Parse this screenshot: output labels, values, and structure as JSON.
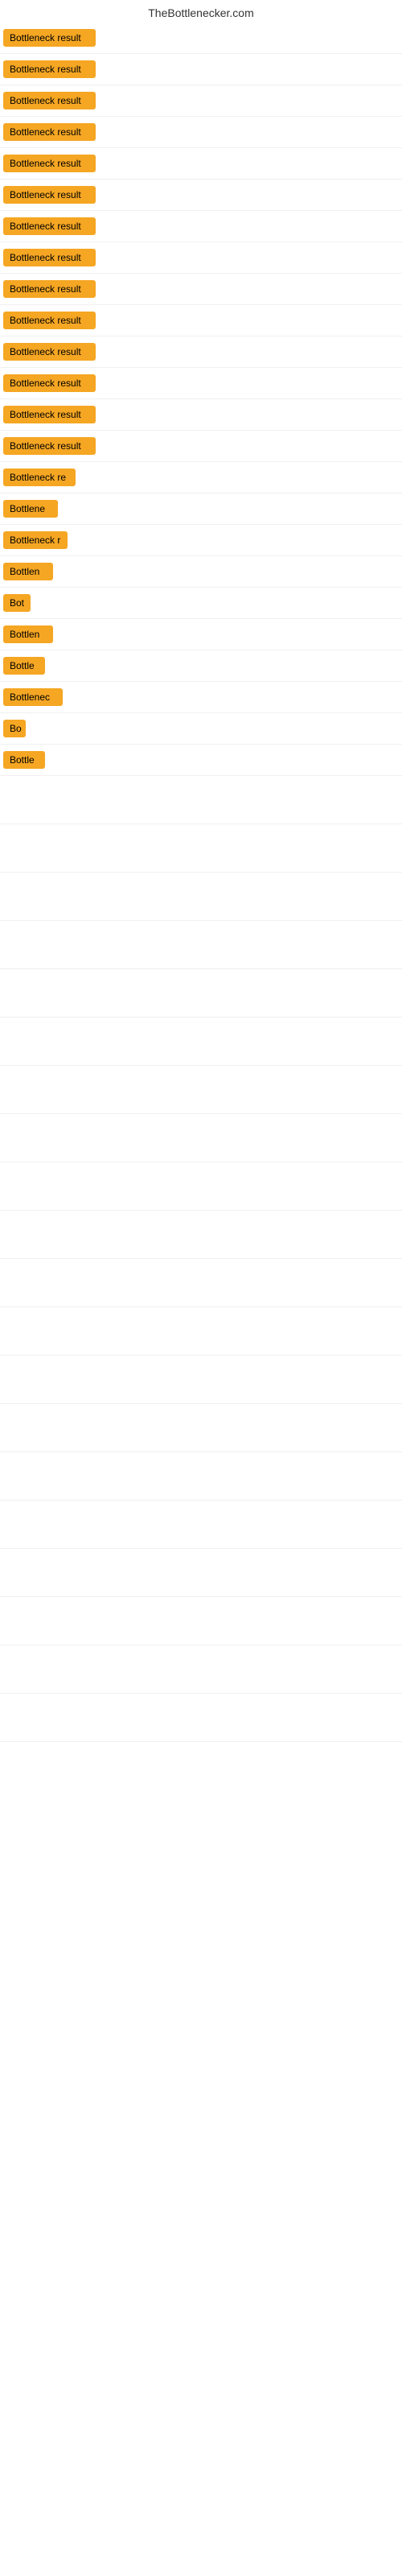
{
  "site": {
    "title": "TheBottlenecker.com"
  },
  "results": [
    {
      "id": 1,
      "label": "Bottleneck result",
      "width": 115
    },
    {
      "id": 2,
      "label": "Bottleneck result",
      "width": 115
    },
    {
      "id": 3,
      "label": "Bottleneck result",
      "width": 115
    },
    {
      "id": 4,
      "label": "Bottleneck result",
      "width": 115
    },
    {
      "id": 5,
      "label": "Bottleneck result",
      "width": 115
    },
    {
      "id": 6,
      "label": "Bottleneck result",
      "width": 115
    },
    {
      "id": 7,
      "label": "Bottleneck result",
      "width": 115
    },
    {
      "id": 8,
      "label": "Bottleneck result",
      "width": 115
    },
    {
      "id": 9,
      "label": "Bottleneck result",
      "width": 115
    },
    {
      "id": 10,
      "label": "Bottleneck result",
      "width": 115
    },
    {
      "id": 11,
      "label": "Bottleneck result",
      "width": 115
    },
    {
      "id": 12,
      "label": "Bottleneck result",
      "width": 115
    },
    {
      "id": 13,
      "label": "Bottleneck result",
      "width": 115
    },
    {
      "id": 14,
      "label": "Bottleneck result",
      "width": 115
    },
    {
      "id": 15,
      "label": "Bottleneck re",
      "width": 90
    },
    {
      "id": 16,
      "label": "Bottlene",
      "width": 68
    },
    {
      "id": 17,
      "label": "Bottleneck r",
      "width": 80
    },
    {
      "id": 18,
      "label": "Bottlen",
      "width": 62
    },
    {
      "id": 19,
      "label": "Bot",
      "width": 34
    },
    {
      "id": 20,
      "label": "Bottlen",
      "width": 62
    },
    {
      "id": 21,
      "label": "Bottle",
      "width": 52
    },
    {
      "id": 22,
      "label": "Bottlenec",
      "width": 74
    },
    {
      "id": 23,
      "label": "Bo",
      "width": 28
    },
    {
      "id": 24,
      "label": "Bottle",
      "width": 52
    }
  ],
  "colors": {
    "badge_bg": "#f5a623",
    "badge_text": "#000000",
    "site_title": "#333333"
  }
}
